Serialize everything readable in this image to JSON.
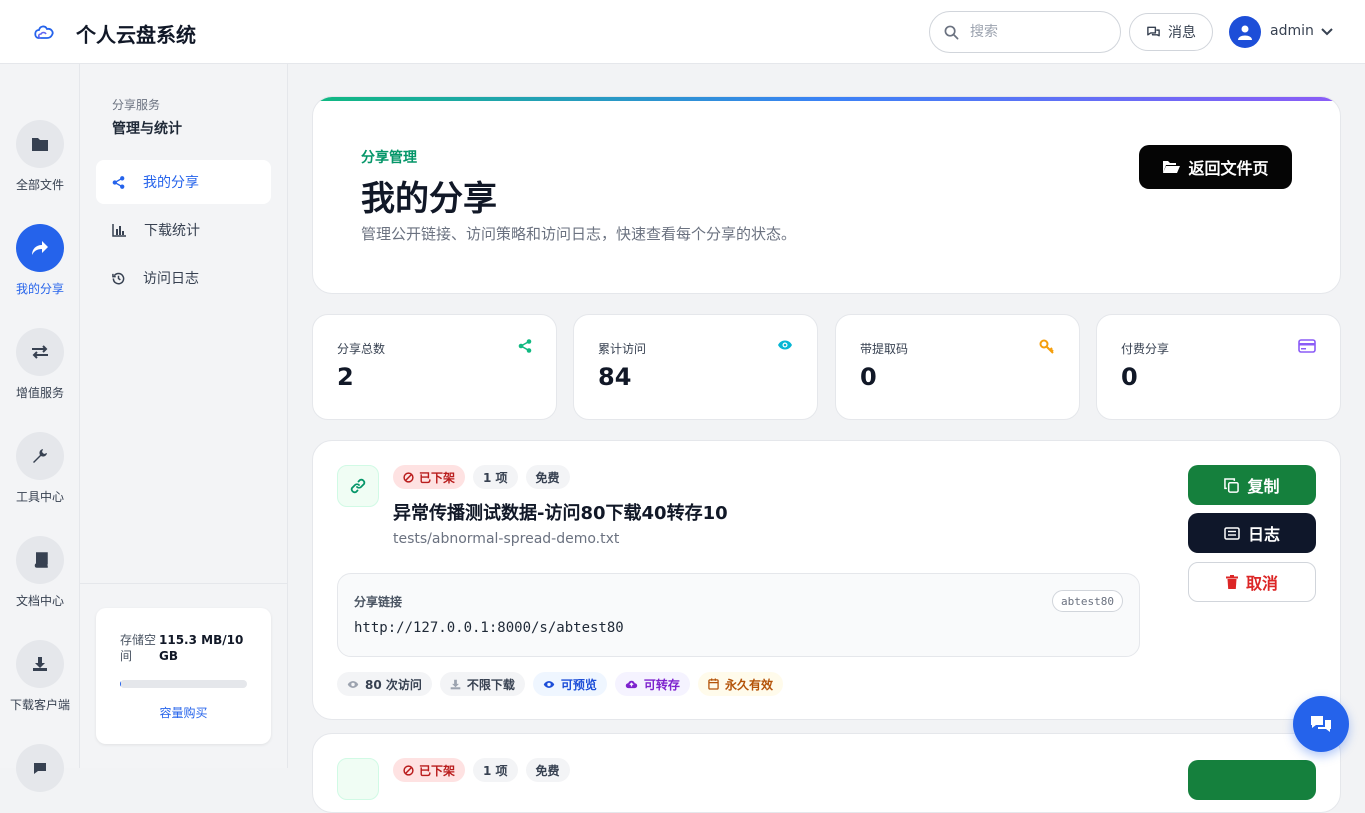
{
  "app": {
    "title": "个人云盘系统"
  },
  "header": {
    "search_placeholder": "搜索",
    "messages_label": "消息",
    "username": "admin"
  },
  "rail": {
    "items": [
      {
        "label": "全部文件",
        "icon": "folder-icon"
      },
      {
        "label": "我的分享",
        "icon": "share-icon",
        "active": true
      },
      {
        "label": "增值服务",
        "icon": "exchange-icon"
      },
      {
        "label": "工具中心",
        "icon": "wrench-icon"
      },
      {
        "label": "文档中心",
        "icon": "book-icon"
      },
      {
        "label": "下载客户端",
        "icon": "download-icon"
      }
    ]
  },
  "subside": {
    "kicker": "分享服务",
    "title": "管理与统计",
    "items": [
      {
        "label": "我的分享",
        "icon": "share-nodes-icon",
        "active": true
      },
      {
        "label": "下载统计",
        "icon": "bar-chart-icon"
      },
      {
        "label": "访问日志",
        "icon": "history-icon"
      }
    ],
    "storage": {
      "label": "存储空间",
      "value": "115.3 MB/10 GB",
      "used_fraction": 0.011,
      "buy_label": "容量购买"
    }
  },
  "hero": {
    "kicker": "分享管理",
    "title": "我的分享",
    "description": "管理公开链接、访问策略和访问日志，快速查看每个分享的状态。",
    "back_button": "返回文件页"
  },
  "stats": [
    {
      "label": "分享总数",
      "value": "2",
      "icon": "share-nodes-icon",
      "color": "#10b981"
    },
    {
      "label": "累计访问",
      "value": "84",
      "icon": "eye-icon",
      "color": "#06b6d4"
    },
    {
      "label": "带提取码",
      "value": "0",
      "icon": "key-icon",
      "color": "#f59e0b"
    },
    {
      "label": "付费分享",
      "value": "0",
      "icon": "credit-card-icon",
      "color": "#8b5cf6"
    }
  ],
  "shares": [
    {
      "status": "已下架",
      "count": "1 项",
      "price": "免费",
      "name": "异常传播测试数据-访问80下载40转存10",
      "path": "tests/abnormal-spread-demo.txt",
      "link_label": "分享链接",
      "code": "abtest80",
      "url": "http://127.0.0.1:8000/s/abtest80",
      "chips": {
        "visits": "80 次访问",
        "download": "不限下载",
        "preview": "可预览",
        "transfer": "可转存",
        "expiry": "永久有效"
      },
      "actions": {
        "copy": "复制",
        "log": "日志",
        "cancel": "取消"
      }
    },
    {
      "status": "已下架",
      "count": "1 项",
      "price": "免费"
    }
  ]
}
